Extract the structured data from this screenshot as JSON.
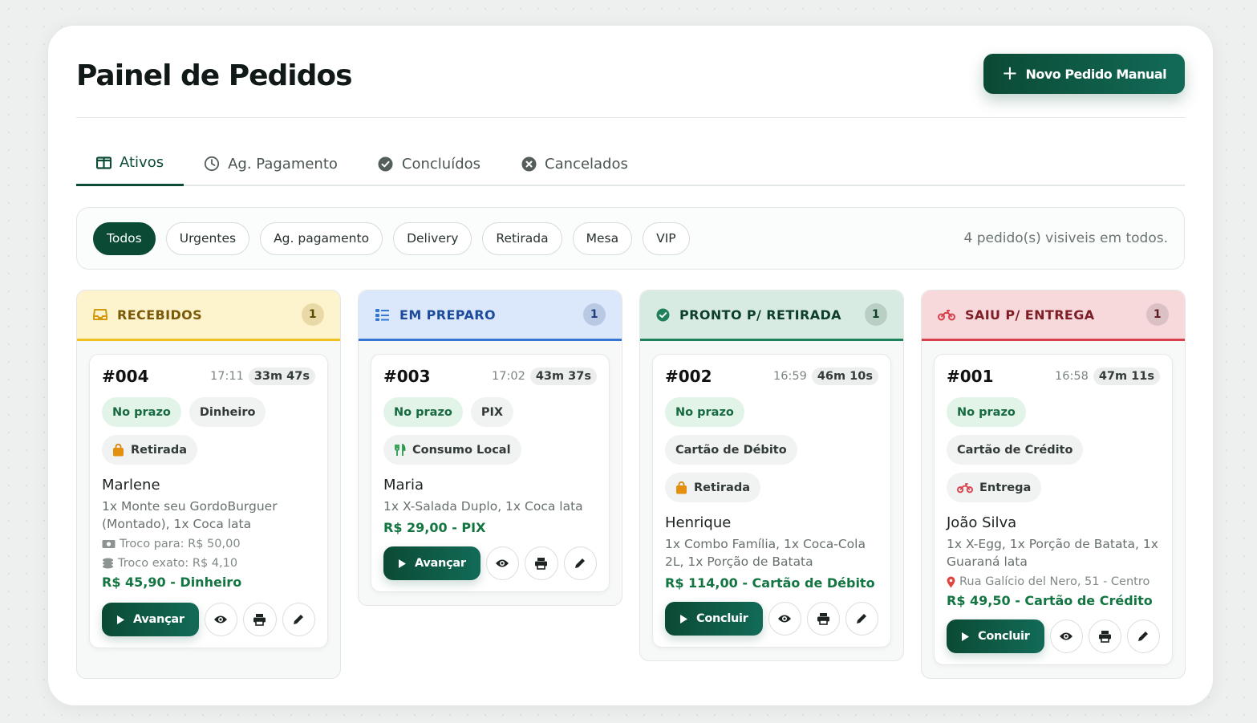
{
  "header": {
    "title": "Painel de Pedidos",
    "new_order_label": "Novo Pedido Manual"
  },
  "tabs": [
    {
      "label": "Ativos",
      "icon": "columns-icon"
    },
    {
      "label": "Ag. Pagamento",
      "icon": "clock-icon"
    },
    {
      "label": "Concluídos",
      "icon": "check-circle-icon"
    },
    {
      "label": "Cancelados",
      "icon": "x-circle-icon"
    }
  ],
  "filters": {
    "chips": [
      "Todos",
      "Urgentes",
      "Ag. pagamento",
      "Delivery",
      "Retirada",
      "Mesa",
      "VIP"
    ],
    "count_text": "4 pedido(s) visiveis em todos."
  },
  "columns": [
    {
      "title": "RECEBIDOS",
      "count": "1",
      "icon": "inbox-icon",
      "cards": [
        {
          "number": "#004",
          "time": "17:11",
          "elapsed": "33m 47s",
          "status": "No prazo",
          "payment": "Dinheiro",
          "mode": "Retirada",
          "customer": "Marlene",
          "items": "1x Monte seu GordoBurguer (Montado), 1x Coca lata",
          "change_for": "Troco para: R$ 50,00",
          "change_exact": "Troco exato: R$ 4,10",
          "total": "R$ 45,90 - Dinheiro",
          "action": "Avançar"
        }
      ]
    },
    {
      "title": "EM PREPARO",
      "count": "1",
      "icon": "list-icon",
      "cards": [
        {
          "number": "#003",
          "time": "17:02",
          "elapsed": "43m 37s",
          "status": "No prazo",
          "payment": "PIX",
          "mode": "Consumo Local",
          "customer": "Maria",
          "items": "1x X-Salada Duplo, 1x Coca lata",
          "total": "R$ 29,00 - PIX",
          "action": "Avançar"
        }
      ]
    },
    {
      "title": "PRONTO P/ RETIRADA",
      "count": "1",
      "icon": "check-circle-icon",
      "cards": [
        {
          "number": "#002",
          "time": "16:59",
          "elapsed": "46m 10s",
          "status": "No prazo",
          "payment": "Cartão de Débito",
          "mode": "Retirada",
          "customer": "Henrique",
          "items": "1x Combo Família, 1x Coca-Cola 2L, 1x Porção de Batata",
          "total": "R$ 114,00 - Cartão de Débito",
          "action": "Concluir"
        }
      ]
    },
    {
      "title": "SAIU P/ ENTREGA",
      "count": "1",
      "icon": "motorcycle-icon",
      "cards": [
        {
          "number": "#001",
          "time": "16:58",
          "elapsed": "47m 11s",
          "status": "No prazo",
          "payment": "Cartão de Crédito",
          "mode": "Entrega",
          "customer": "João Silva",
          "items": "1x X-Egg, 1x Porção de Batata, 1x Guaraná lata",
          "address": "Rua Galício del Nero, 51 - Centro",
          "total": "R$ 49,50 - Cartão de Crédito",
          "action": "Concluir"
        }
      ]
    }
  ],
  "colors": {
    "primary": "#0b4a35",
    "received": "#f1c021",
    "preparing": "#3476d1",
    "ready": "#1f8159",
    "delivery": "#d8404c",
    "total": "#137541"
  }
}
